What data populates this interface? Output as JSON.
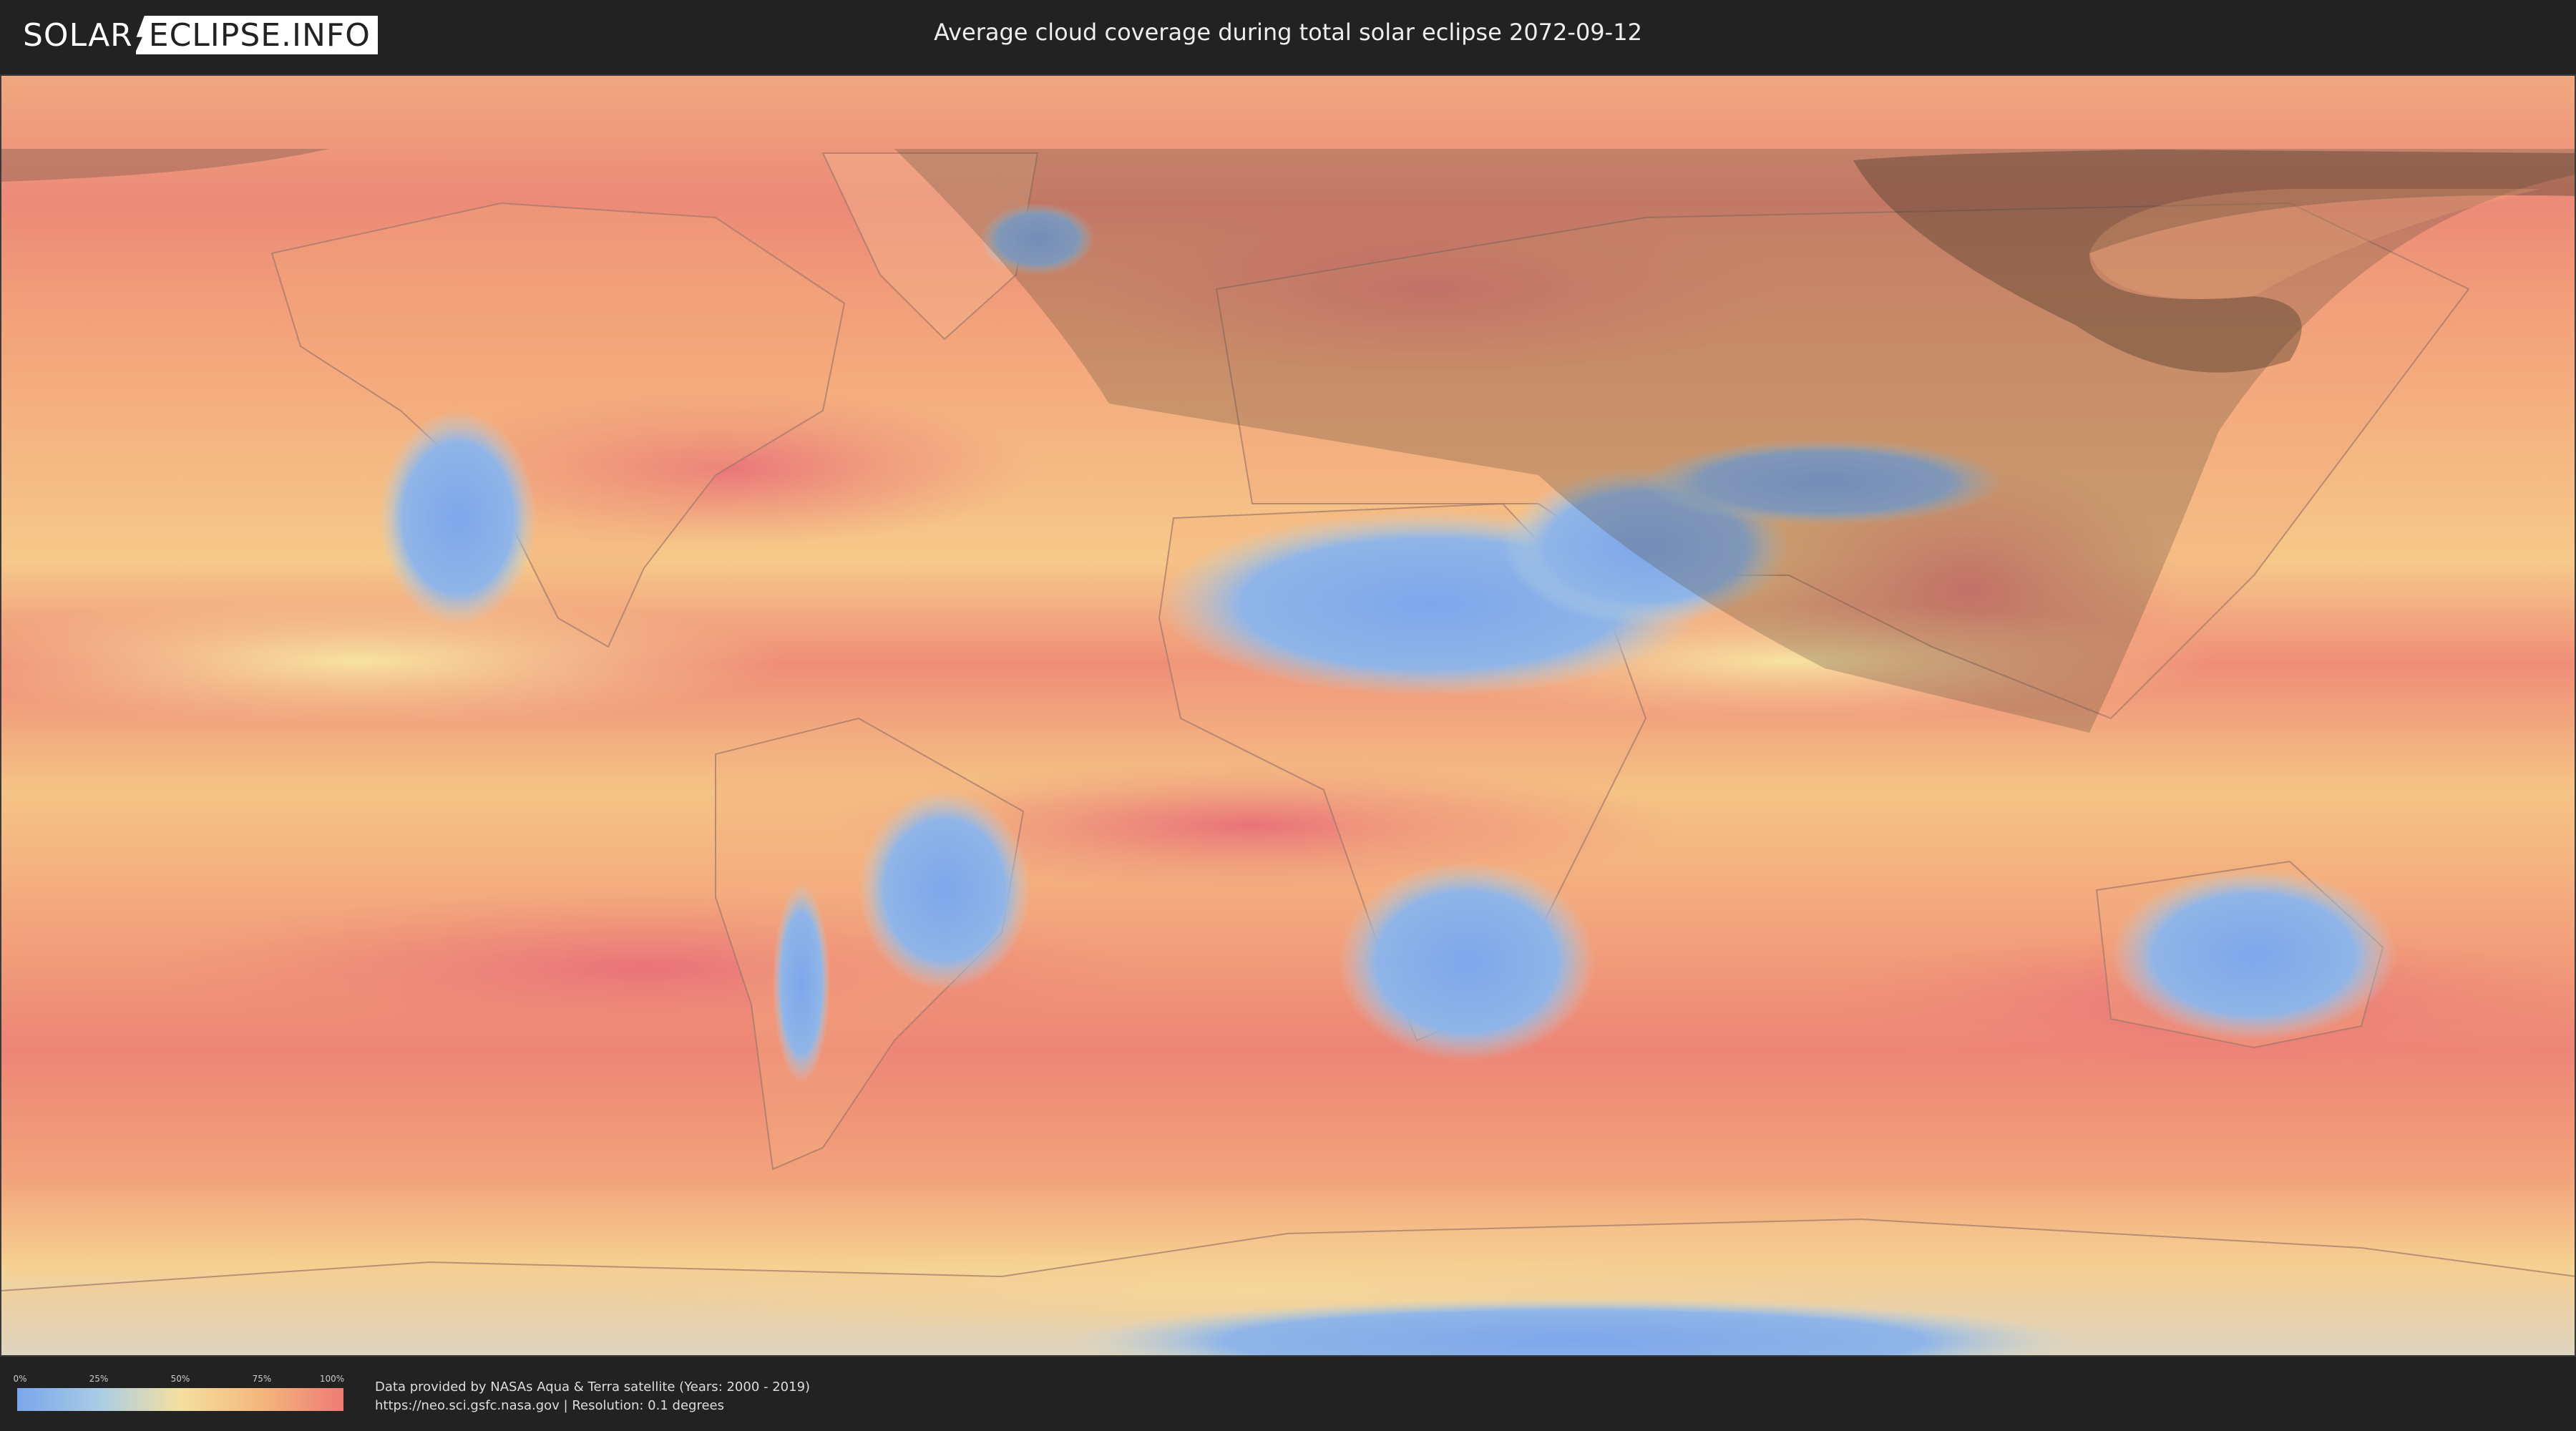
{
  "header": {
    "logo_left": "SOLAR",
    "logo_right": "ECLIPSE.INFO",
    "title": "Average cloud coverage during total solar eclipse 2072-09-12"
  },
  "map": {
    "type": "world cloud coverage map",
    "colors": {
      "clear": "#7aa6ec",
      "low": "#a9cce4",
      "mid": "#f4e0a0",
      "high": "#f4b67c",
      "overcast": "#ee7b76",
      "eclipse_shadow": "#5a4a3a"
    }
  },
  "legend": {
    "ticks": [
      "0%",
      "25%",
      "50%",
      "75%",
      "100%"
    ]
  },
  "footer": {
    "credit_line1": "Data provided by NASAs Aqua & Terra satellite (Years: 2000 - 2019)",
    "credit_line2": "https://neo.sci.gsfc.nasa.gov | Resolution: 0.1 degrees"
  }
}
